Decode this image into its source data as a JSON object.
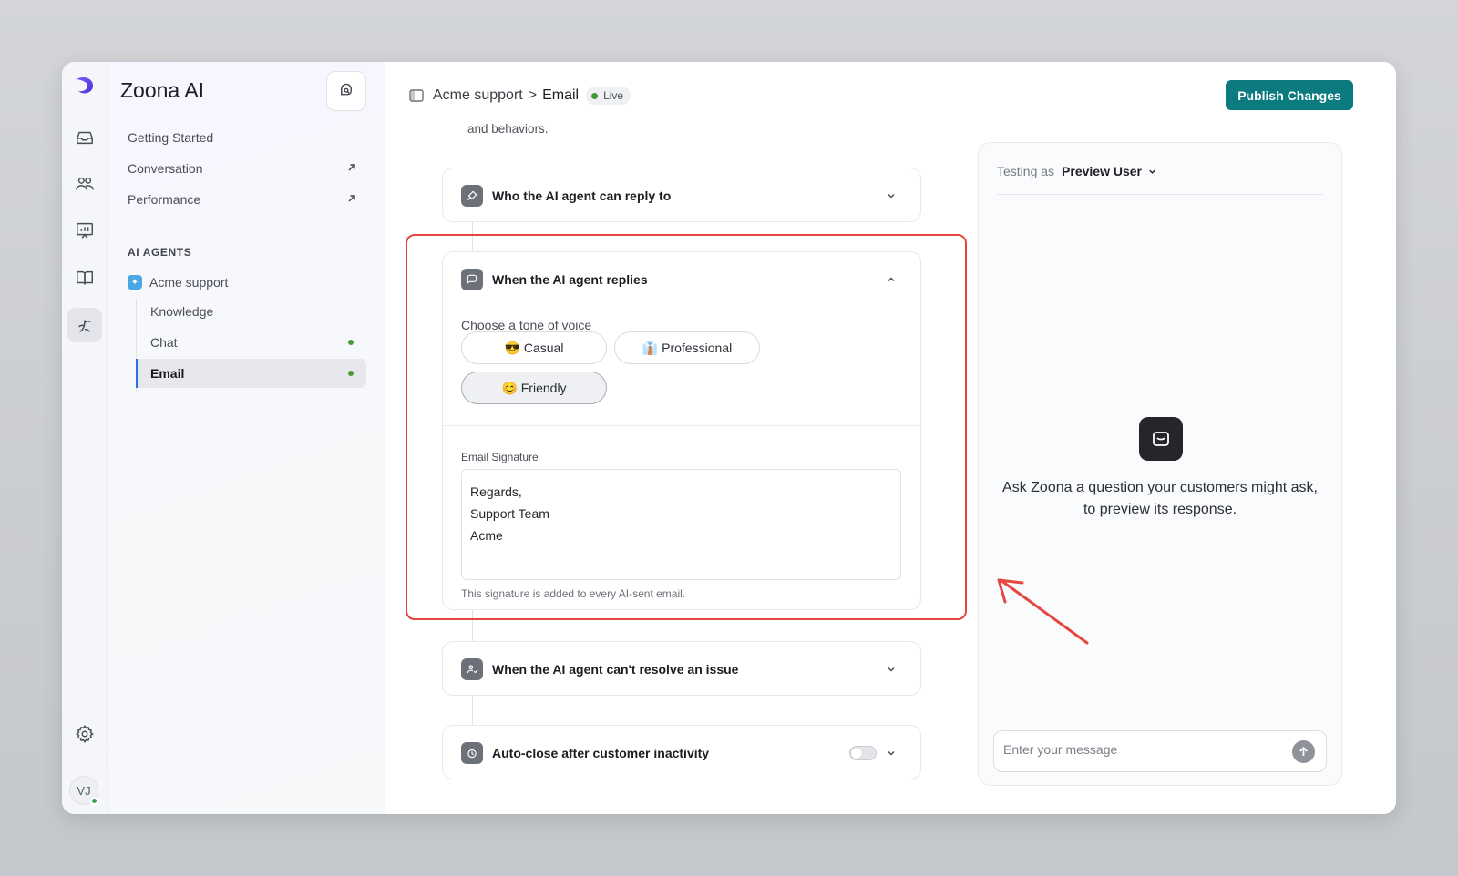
{
  "app": {
    "name": "Zoona AI"
  },
  "sidebar": {
    "nav": [
      {
        "label": "Getting Started"
      },
      {
        "label": "Conversation"
      },
      {
        "label": "Performance"
      }
    ],
    "section_label": "AI AGENTS",
    "agent": {
      "label": "Acme support"
    },
    "sub_items": [
      {
        "label": "Knowledge"
      },
      {
        "label": "Chat"
      },
      {
        "label": "Email"
      }
    ]
  },
  "user": {
    "initials": "VJ"
  },
  "header": {
    "breadcrumb_parent": "Acme support",
    "breadcrumb_separator": ">",
    "breadcrumb_current": "Email",
    "status_badge": "Live",
    "publish_label": "Publish Changes"
  },
  "content": {
    "intro_fragment": "and behaviors.",
    "sections": [
      {
        "title": "Who the AI agent can reply to"
      },
      {
        "title": "When the AI agent replies"
      },
      {
        "title": "When the AI agent can't resolve an issue"
      },
      {
        "title": "Auto-close after customer inactivity"
      }
    ],
    "tone": {
      "label": "Choose a tone of voice",
      "options": [
        {
          "label": "😎 Casual"
        },
        {
          "label": "👔 Professional"
        },
        {
          "label": "😊 Friendly"
        }
      ],
      "selected": "😊 Friendly"
    },
    "signature": {
      "label": "Email Signature",
      "value": "Regards,\nSupport Team\nAcme",
      "help": "This signature is added to every AI-sent email."
    },
    "auto_close_enabled": false
  },
  "preview": {
    "testing_as_label": "Testing as",
    "testing_user": "Preview User",
    "empty_message": "Ask Zoona a question your customers might ask, to preview its response.",
    "input_placeholder": "Enter your message"
  },
  "colors": {
    "accent": "#0b7b80",
    "live": "#3f9a3a",
    "annotation": "#e5473f"
  }
}
